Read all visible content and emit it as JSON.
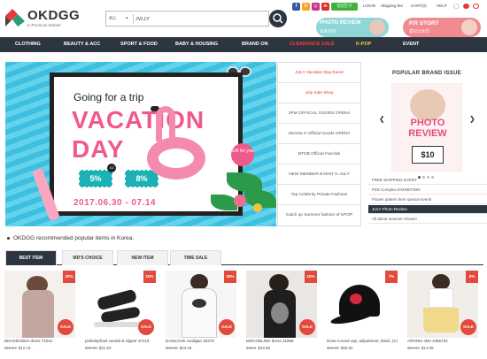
{
  "header": {
    "logo_text": "OKDGG",
    "logo_sub": "K-Premium Market",
    "search_category": "ALL",
    "search_value": "JVLLY",
    "kakao": "QQ친구",
    "top_links": [
      "LOGIN",
      "Shipping fee",
      "CART(0)",
      "HELP"
    ],
    "promo1": {
      "title": "PHOTO REVIEW",
      "sub": "포토리뷰"
    },
    "promo2": {
      "title": "P.R STORY",
      "sub": "홍보스토리"
    }
  },
  "nav": [
    "CLOTHING",
    "BEAUTY & ACC",
    "SPORT & FOOD",
    "BABY & HOUSING",
    "BRAND ON",
    "CLEARANCE SALE",
    "K-POP",
    "EVENT"
  ],
  "colors": {
    "nav_bg": "#2d3540",
    "accent_red": "#e44a3c",
    "clearance": "#ff3b3b",
    "kpop": "#f5d020",
    "pink": "#f05a8a"
  },
  "banner": {
    "line1": "Going for a trip",
    "line2": "VACATION",
    "line3": "DAY",
    "coupon1": "5%",
    "coupon2": "8%",
    "x2": "X2",
    "dates": "2017.06.30 - 07.14",
    "gift": "Gift for you"
  },
  "events": [
    "JULY Vacation Day Event",
    "July Sale Shop",
    "2PM OFFICIAL GOODS OPEN!!",
    "Monsta X Official Goods OPEN!!",
    "BTOB Official Fanclub",
    "NEW MEMBER EVENT in JULY",
    "Top Celebrity Private Fashion!",
    "Catch up Summer fashion of KPOP"
  ],
  "popular": {
    "title": "POPULAR BRAND ISSUE",
    "img_text": "PHOTO REVIEW",
    "coupon": "$10",
    "items": [
      "FREE SHIPPING EVENT",
      "Pink Complex EXHIBITION",
      "Flower pattern item special event!",
      "JULY Photo Review",
      "All about summer shoes!!"
    ]
  },
  "recommend": "OKDGG recommended popular items in Korea.",
  "tabs": [
    "BEST ITEM",
    "MD'S CHOICE",
    "NEW ITEM",
    "TIME SALE"
  ],
  "products": [
    {
      "name": "DDADDADDA dress 71041",
      "old": "$15.54",
      "price": "$12.18",
      "pct": "20%",
      "sale": "SALE"
    },
    {
      "name": "pinkelephant candal & slipper 37418",
      "old": "$35.28",
      "price": "$31.83",
      "pct": "10%",
      "sale": "SALE"
    },
    {
      "name": "DASILOVE cardigan 30379",
      "old": "$46.52",
      "price": "$23.05",
      "pct": "20%",
      "sale": "SALE"
    },
    {
      "name": "MOCOBLING dress 31968",
      "old": "$48.4",
      "price": "$43.88",
      "pct": "10%",
      "sale": "SALE"
    },
    {
      "name": "Rose-curved cap, adjustment, black, (CCPPTC-1-SL)",
      "old": "$64.13",
      "price": "$59.65",
      "pct": "7%",
      "sale": ""
    },
    {
      "name": "ARONKI skirt 1065733",
      "old": "$15.84",
      "price": "$14.08",
      "pct": "6%",
      "sale": "SALE"
    }
  ]
}
